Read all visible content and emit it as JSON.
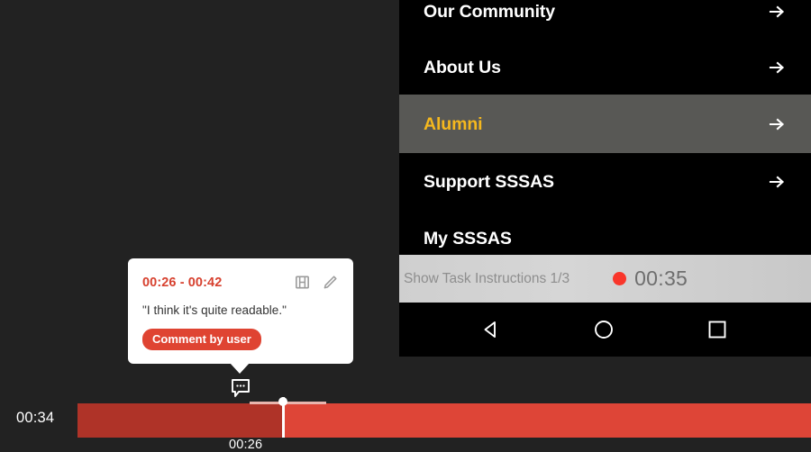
{
  "background_color": "#222222",
  "phone": {
    "menu": {
      "items": [
        {
          "label": "Our Community",
          "arrow_icon": "arrow-right-icon",
          "highlighted": false
        },
        {
          "label": "About Us",
          "arrow_icon": "arrow-right-icon",
          "highlighted": false
        },
        {
          "label": "Alumni",
          "arrow_icon": "arrow-right-icon",
          "highlighted": true
        },
        {
          "label": "Support SSSAS",
          "arrow_icon": "arrow-right-icon",
          "highlighted": false
        },
        {
          "label": "My SSSAS",
          "arrow_icon": "",
          "highlighted": false
        }
      ],
      "highlight_bg": "#585855",
      "highlight_text_color": "#f5b81e"
    },
    "task_bar": {
      "instructions_label": "Show Task Instructions 1/3",
      "record_icon": "record-dot-icon",
      "record_color": "#f9362b",
      "elapsed_time": "00:35"
    },
    "nav_bar": {
      "back_icon": "triangle-back-icon",
      "home_icon": "circle-home-icon",
      "recents_icon": "square-recents-icon"
    }
  },
  "comment_card": {
    "time_range": "00:26 - 00:42",
    "range_color": "#d7412f",
    "film_icon": "film-strip-icon",
    "edit_icon": "pencil-edit-icon",
    "text": "\"I think it's quite readable.\"",
    "badge_label": "Comment by user",
    "badge_color": "#df4432"
  },
  "timeline": {
    "total_duration_label": "00:34",
    "playhead_time_label": "00:26",
    "marker_icon": "comment-bubble-icon",
    "progress_color": "#af3328",
    "track_color": "#de4537"
  }
}
